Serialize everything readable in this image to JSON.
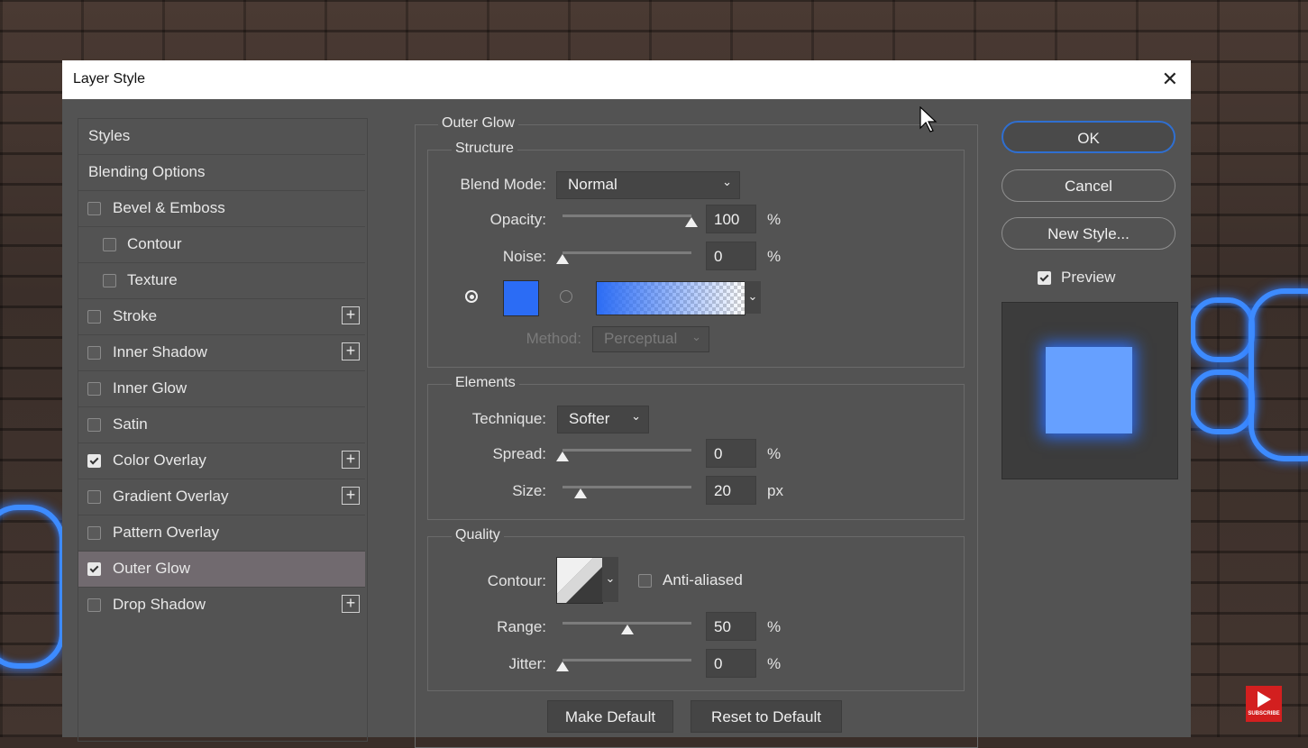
{
  "window": {
    "title": "Layer Style",
    "close_icon": "close-icon"
  },
  "styles_panel": {
    "items": [
      {
        "label": "Styles",
        "checkbox": null,
        "plus": false,
        "selected": false
      },
      {
        "label": "Blending Options",
        "checkbox": null,
        "plus": false,
        "selected": false
      },
      {
        "label": "Bevel & Emboss",
        "checkbox": false,
        "plus": false,
        "selected": false
      },
      {
        "label": "Contour",
        "checkbox": false,
        "plus": false,
        "selected": false,
        "indent": true
      },
      {
        "label": "Texture",
        "checkbox": false,
        "plus": false,
        "selected": false,
        "indent": true
      },
      {
        "label": "Stroke",
        "checkbox": false,
        "plus": true,
        "selected": false
      },
      {
        "label": "Inner Shadow",
        "checkbox": false,
        "plus": true,
        "selected": false
      },
      {
        "label": "Inner Glow",
        "checkbox": false,
        "plus": false,
        "selected": false
      },
      {
        "label": "Satin",
        "checkbox": false,
        "plus": false,
        "selected": false
      },
      {
        "label": "Color Overlay",
        "checkbox": true,
        "plus": true,
        "selected": false
      },
      {
        "label": "Gradient Overlay",
        "checkbox": false,
        "plus": true,
        "selected": false
      },
      {
        "label": "Pattern Overlay",
        "checkbox": false,
        "plus": false,
        "selected": false
      },
      {
        "label": "Outer Glow",
        "checkbox": true,
        "plus": false,
        "selected": true
      },
      {
        "label": "Drop Shadow",
        "checkbox": false,
        "plus": true,
        "selected": false
      }
    ]
  },
  "outer_glow": {
    "title": "Outer Glow",
    "structure": {
      "title": "Structure",
      "blend_mode_label": "Blend Mode:",
      "blend_mode_value": "Normal",
      "opacity_label": "Opacity:",
      "opacity_value": "100",
      "opacity_unit": "%",
      "opacity_level": 1.0,
      "noise_label": "Noise:",
      "noise_value": "0",
      "noise_unit": "%",
      "noise_level": 0.0,
      "color_swatch": "#2b6cf5",
      "method_label": "Method:",
      "method_value": "Perceptual"
    },
    "elements": {
      "title": "Elements",
      "technique_label": "Technique:",
      "technique_value": "Softer",
      "spread_label": "Spread:",
      "spread_value": "0",
      "spread_unit": "%",
      "spread_level": 0.0,
      "size_label": "Size:",
      "size_value": "20",
      "size_unit": "px",
      "size_level": 0.14
    },
    "quality": {
      "title": "Quality",
      "contour_label": "Contour:",
      "anti_aliased_label": "Anti-aliased",
      "anti_aliased": false,
      "range_label": "Range:",
      "range_value": "50",
      "range_unit": "%",
      "range_level": 0.5,
      "jitter_label": "Jitter:",
      "jitter_value": "0",
      "jitter_unit": "%",
      "jitter_level": 0.0
    },
    "make_default_label": "Make Default",
    "reset_default_label": "Reset to Default"
  },
  "actions": {
    "ok_label": "OK",
    "cancel_label": "Cancel",
    "new_style_label": "New Style...",
    "preview_label": "Preview",
    "preview_checked": true
  },
  "preview_color": "#66a0ff",
  "watermark_text": "SUBSCRIBE"
}
